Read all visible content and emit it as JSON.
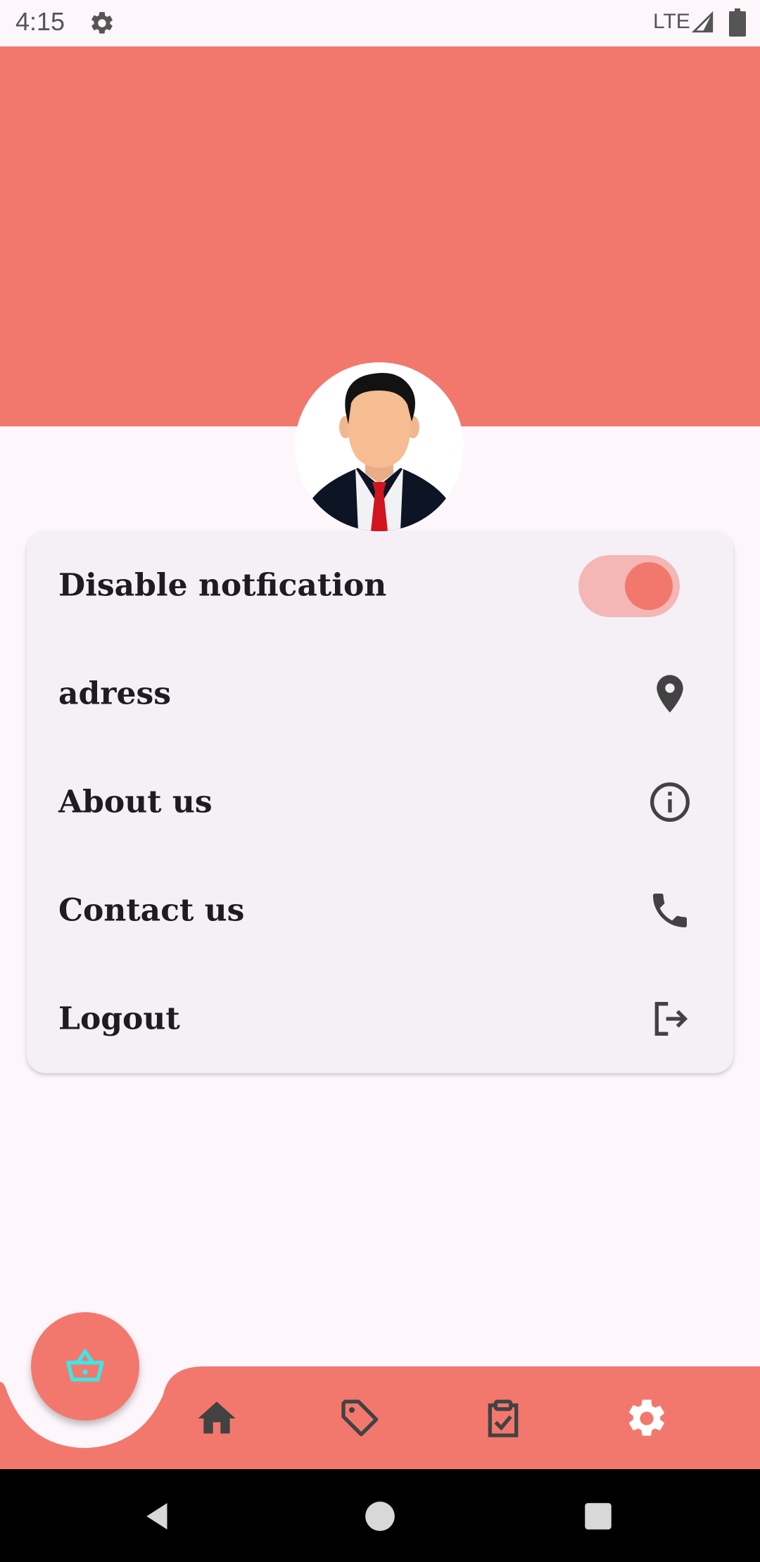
{
  "status_bar": {
    "time": "4:15",
    "network": "LTE",
    "icons": [
      "gear-icon",
      "signal-icon",
      "battery-icon"
    ]
  },
  "colors": {
    "accent": "#f2786e",
    "toggle_track": "#f5b6b6",
    "background": "#fdf6fb",
    "card": "#f4f0f6",
    "icon": "#424242",
    "fab_icon": "#3ee6e6"
  },
  "profile": {
    "avatar": "businessman-avatar"
  },
  "settings": {
    "items": [
      {
        "label": "Disable notfication",
        "control": "toggle",
        "toggle_on": true
      },
      {
        "label": "adress",
        "icon": "location-pin-icon"
      },
      {
        "label": "About us",
        "icon": "info-icon"
      },
      {
        "label": "Contact us",
        "icon": "phone-icon"
      },
      {
        "label": "Logout",
        "icon": "logout-icon"
      }
    ]
  },
  "fab": {
    "icon": "basket-icon"
  },
  "bottom_nav": {
    "items": [
      {
        "icon": "home-icon",
        "active": false
      },
      {
        "icon": "tag-icon",
        "active": false
      },
      {
        "icon": "clipboard-check-icon",
        "active": false
      },
      {
        "icon": "gear-icon",
        "active": true
      }
    ]
  },
  "system_nav": {
    "buttons": [
      "back-icon",
      "home-circle-icon",
      "recents-icon"
    ]
  }
}
